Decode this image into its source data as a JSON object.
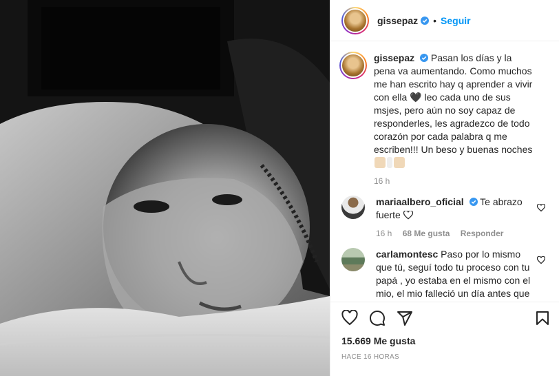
{
  "post": {
    "author": "gissepaz",
    "follow_label": "Seguir",
    "separator": "•"
  },
  "caption": {
    "author": "gissepaz",
    "text": "Pasan los días y la pena va aumentando. Como muchos me han escrito hay q aprender a vivir con ella 🖤 leo cada uno de sus msjes, pero aún no soy capaz de responderles, les agradezco de todo corazón por cada palabra q me escriben!!! Un beso y buenas noches",
    "time": "16 h"
  },
  "comments": [
    {
      "author": "mariaalbero_oficial",
      "text": "Te abrazo fuerte",
      "time": "16 h",
      "likes": "68 Me gusta",
      "reply": "Responder"
    },
    {
      "author": "carlamontesc",
      "text": "Paso por lo mismo que tú, seguí todo tu proceso con tu papá , yo estaba en el mismo con el mio, el mio falleció un día antes que el tuyo, te entiendo tanto y te mando"
    }
  ],
  "footer": {
    "likes": "15.669 Me gusta",
    "ago": "HACE 16 HORAS"
  },
  "colors": {
    "accent": "#0095f6",
    "verified": "#3897f0",
    "muted": "#8e8e8e"
  }
}
